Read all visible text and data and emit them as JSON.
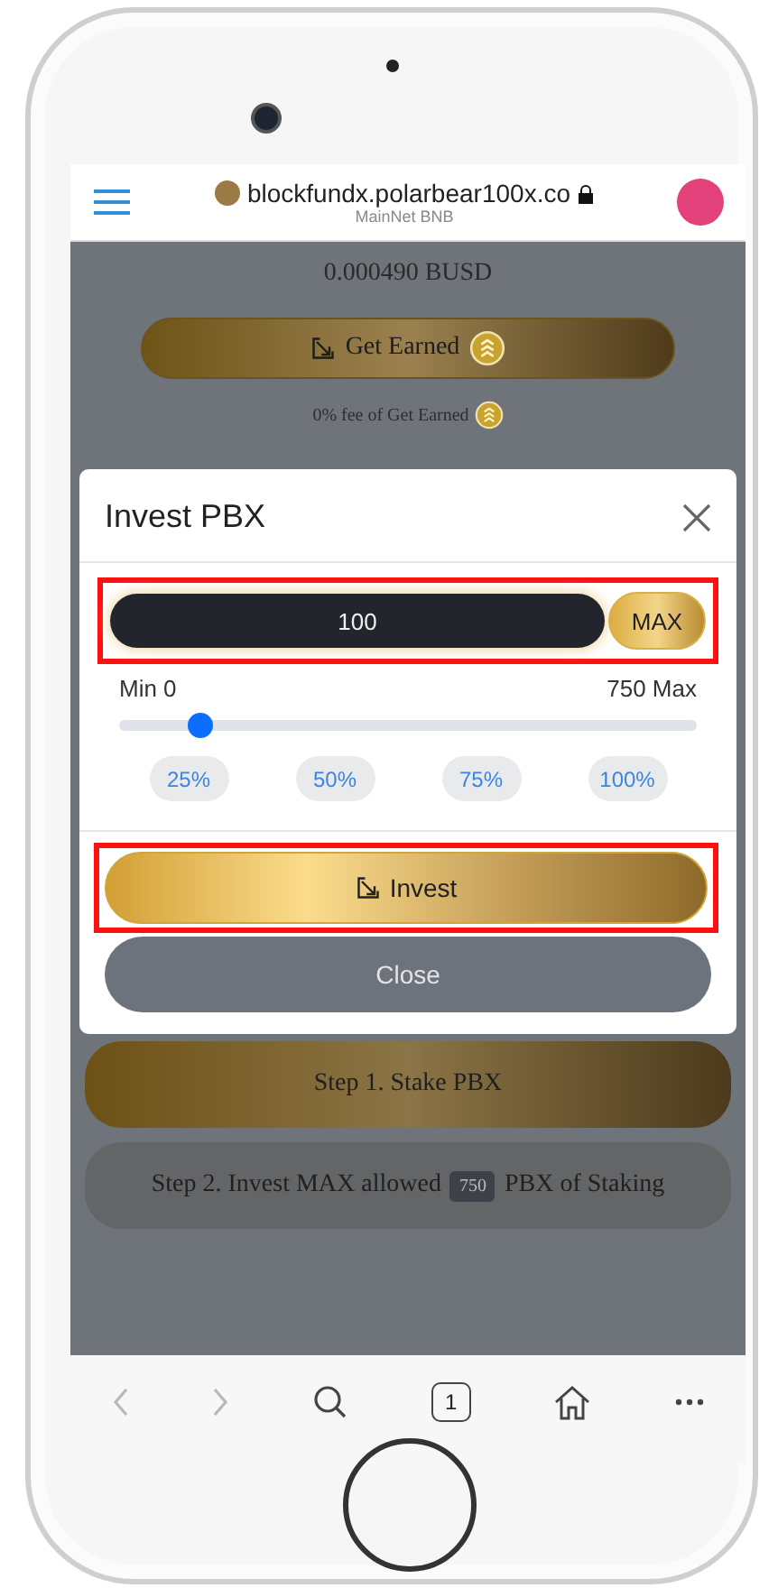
{
  "browser": {
    "address": "blockfundx.polarbear100x.co",
    "network": "MainNet BNB"
  },
  "page": {
    "balance": "0.000490 BUSD",
    "earn_button": "Get Earned",
    "fee_note": "0% fee of Get Earned"
  },
  "modal": {
    "title": "Invest PBX",
    "amount": "100",
    "max_button": "MAX",
    "min_label": "Min 0",
    "max_label": "750 Max",
    "slider": {
      "level": 0.14
    },
    "percent_buttons": [
      "25%",
      "50%",
      "75%",
      "100%"
    ],
    "invest_button": "Invest",
    "close_button": "Close"
  },
  "steps": [
    {
      "kind": "gold",
      "text": "Step 1. Stake PBX"
    },
    {
      "kind": "grey",
      "text": "Step 2. Invest MAX allowed",
      "badge": "750",
      "suffix": "PBX of Staking"
    }
  ],
  "toolbar": {
    "back": {
      "disabled": true
    },
    "forward": {
      "disabled": true
    },
    "tab_count": "1"
  }
}
